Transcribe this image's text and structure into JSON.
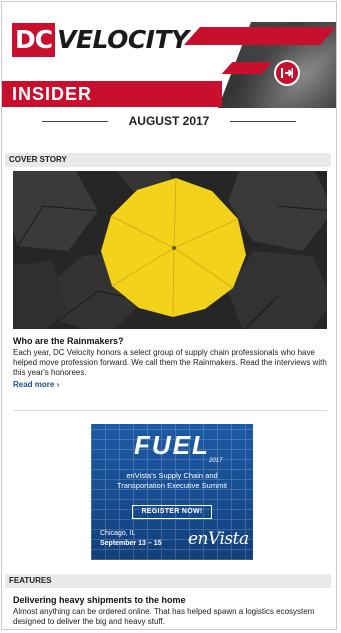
{
  "header": {
    "logo_dc": "DC",
    "logo_velocity": "VELOCITY",
    "banner_label": "INSIDER"
  },
  "date_label": "AUGUST 2017",
  "cover": {
    "section_label": "COVER STORY",
    "title": "Who are the Rainmakers?",
    "body": "Each year, DC Velocity honors a select group of supply chain professionals who have helped move profession forward. We call them the Rainmakers. Read the interviews with this year's honorees.",
    "read_more": "Read more ›"
  },
  "ad": {
    "headline": "FUEL",
    "year": "2017",
    "subtitle_line1": "enVista's Supply Chain and",
    "subtitle_line2": "Transportation Executive Summit",
    "button_label": "REGISTER NOW!",
    "location": "Chicago, IL",
    "dates": "September 13 – 15",
    "brand": "enVista"
  },
  "features": {
    "section_label": "FEATURES",
    "title": "Delivering heavy shipments to the home",
    "body": "Almost anything can be ordered online. That has helped spawn a logistics ecosystem designed to deliver the big and heavy stuff."
  },
  "colors": {
    "brand_red": "#c8102e",
    "link_blue": "#1b4f8c",
    "umbrella_yellow": "#f2d21b",
    "ad_blue": "#1d5aa5"
  },
  "icons": {
    "exit": "exit-icon"
  }
}
